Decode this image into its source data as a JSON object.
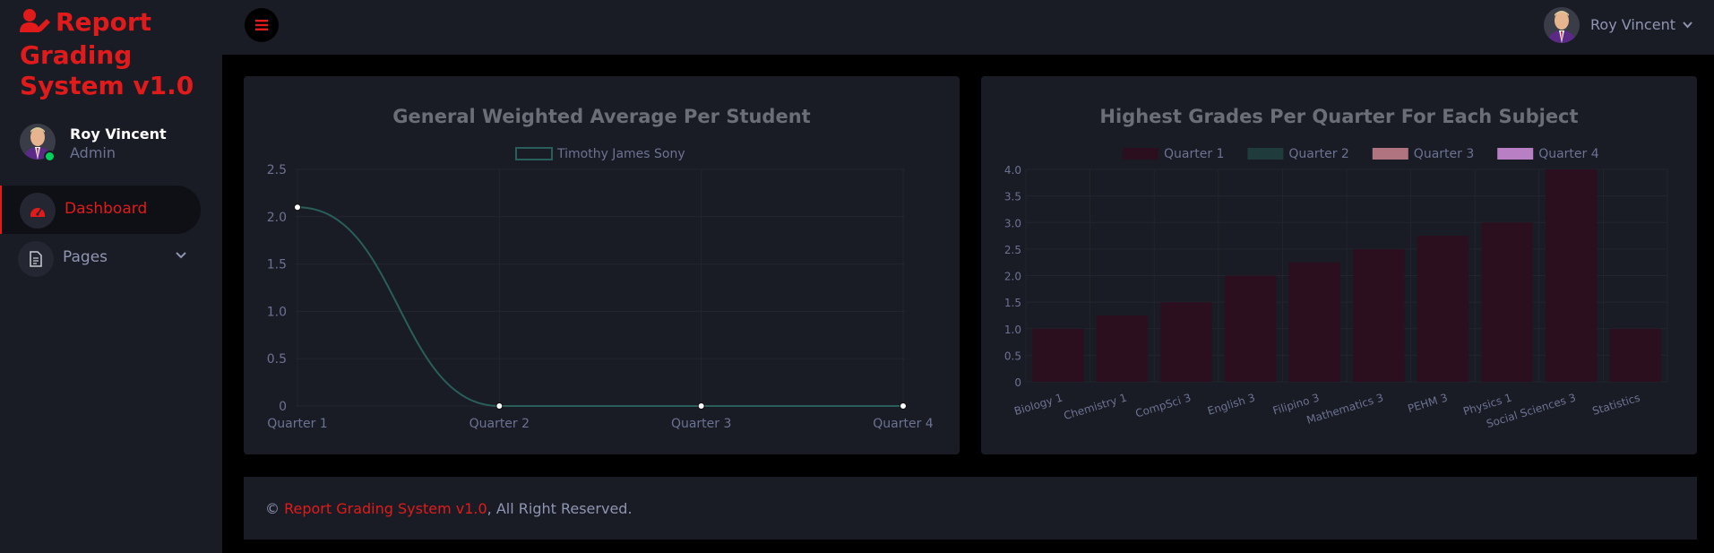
{
  "brand": {
    "title": "Report Grading System v1.0",
    "color": "#e11b1b"
  },
  "sidebar": {
    "profile": {
      "name": "Roy Vincent",
      "role": "Admin",
      "status": "online"
    },
    "nav": [
      {
        "label": "Dashboard",
        "icon": "speedometer-icon",
        "active": true
      },
      {
        "label": "Pages",
        "icon": "file-document-icon",
        "active": false,
        "expandable": true
      }
    ]
  },
  "topbar": {
    "menu_icon": "menu-icon",
    "user_name": "Roy Vincent"
  },
  "charts": {
    "gwa": {
      "title": "General Weighted Average Per Student",
      "legend": "Timothy James Sony"
    },
    "grades": {
      "title": "Highest Grades Per Quarter For Each Subject"
    }
  },
  "chart_data": [
    {
      "type": "line",
      "title": "General Weighted Average Per Student",
      "x": [
        "Quarter 1",
        "Quarter 2",
        "Quarter 3",
        "Quarter 4"
      ],
      "y_ticks": [
        "0",
        "0.5",
        "1.0",
        "1.5",
        "2.0",
        "2.5"
      ],
      "ylim": [
        0,
        2.5
      ],
      "series": [
        {
          "name": "Timothy James Sony",
          "values": [
            2.1,
            0,
            0,
            0
          ],
          "color": "#2a5e5a"
        }
      ],
      "legend_position": "top",
      "grid": true
    },
    {
      "type": "bar",
      "title": "Highest Grades Per Quarter For Each Subject",
      "categories": [
        "Biology 1",
        "Chemistry 1",
        "CompSci 3",
        "English 3",
        "Filipino 3",
        "Mathematics 3",
        "PEHM 3",
        "Physics 1",
        "Social Sciences 3",
        "Statistics"
      ],
      "y_ticks": [
        "0",
        "0.5",
        "1.0",
        "1.5",
        "2.0",
        "2.5",
        "3.0",
        "3.5",
        "4.0"
      ],
      "ylim": [
        0,
        4
      ],
      "series": [
        {
          "name": "Quarter 1",
          "values": [
            1.0,
            1.25,
            1.5,
            2.0,
            2.25,
            2.5,
            2.75,
            3.0,
            4.0,
            1.0
          ],
          "color": "#2b0f1f"
        },
        {
          "name": "Quarter 2",
          "values": [],
          "color": "#1f3b3b"
        },
        {
          "name": "Quarter 3",
          "values": [],
          "color": "#b07480"
        },
        {
          "name": "Quarter 4",
          "values": [],
          "color": "#b87fc4"
        }
      ],
      "legend_position": "top",
      "grid": true
    }
  ],
  "footer": {
    "copyright_symbol": "©",
    "link_text": "Report Grading System v1.0",
    "rest": ", All Right Reserved."
  }
}
